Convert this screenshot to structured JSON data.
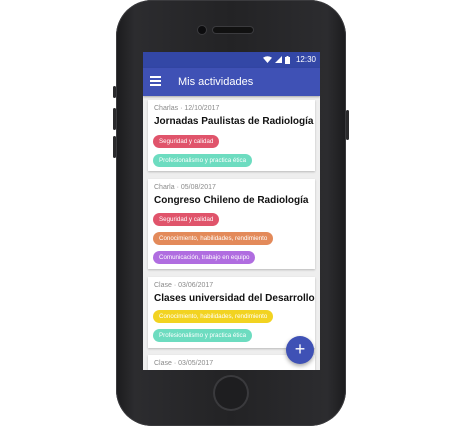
{
  "status": {
    "time": "12:30"
  },
  "appbar": {
    "title": "Mis actividades"
  },
  "cards": [
    {
      "meta": "Charlas · 12/10/2017",
      "title": "Jornadas Paulistas de Radiología",
      "tags": [
        {
          "label": "Seguridad y calidad",
          "color": "#e0546b"
        },
        {
          "label": "Profesionalismo y practica ética",
          "color": "#6ddcc0"
        }
      ]
    },
    {
      "meta": "Charla · 05/08/2017",
      "title": "Congreso Chileno de Radiología",
      "tags": [
        {
          "label": "Seguridad y calidad",
          "color": "#e0546b"
        },
        {
          "label": "Conocimiento, habilidades, rendimiento",
          "color": "#e38a5a"
        },
        {
          "label": "Comunicación, trabajo en equipo",
          "color": "#b06de0"
        }
      ]
    },
    {
      "meta": "Clase · 03/06/2017",
      "title": "Clases universidad del Desarrollo",
      "tags": [
        {
          "label": "Conocimiento, habilidades, rendimiento",
          "color": "#f2d321"
        },
        {
          "label": "Profesionalismo y practica ética",
          "color": "#6ddcc0"
        }
      ]
    },
    {
      "meta": "Clase · 03/05/2017",
      "title": "",
      "tags": []
    }
  ],
  "fab": {
    "label": "+"
  }
}
